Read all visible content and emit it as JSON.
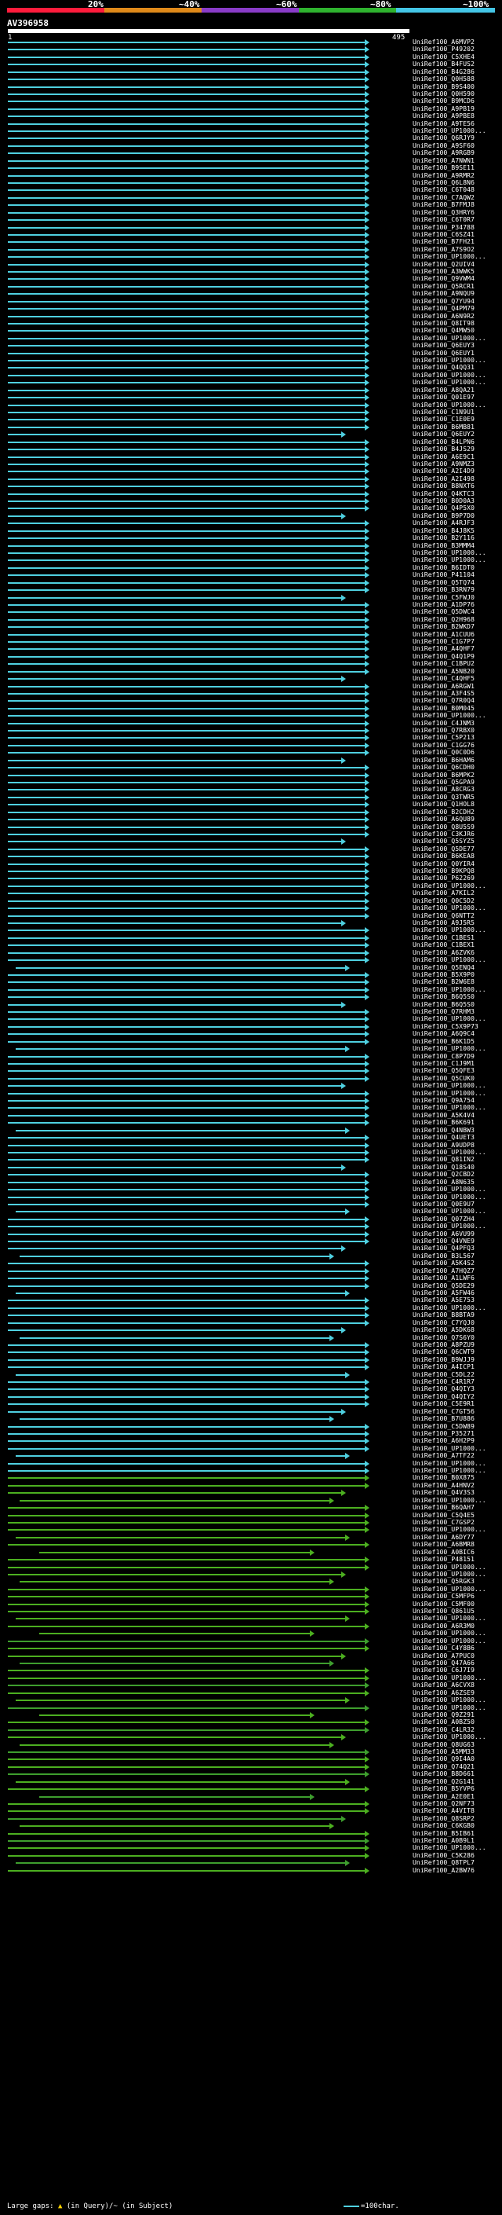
{
  "scale": {
    "labels": [
      "20%",
      "~40%",
      "~60%",
      "~80%",
      "~100%"
    ],
    "colors": [
      "#ff1c3c",
      "#e08a1a",
      "#8a3cc8",
      "#2fb32f",
      "#44c6e6"
    ]
  },
  "query": {
    "name": "AV396958",
    "start": "1",
    "end": "495"
  },
  "legend": {
    "text_a": "Large gaps: ",
    "text_b": " (in Query)/",
    "text_c": "~ (in Subject)",
    "right": "=100char."
  },
  "hits": [
    "UniRef100_A6MVP2",
    "UniRef100_P49202",
    "UniRef100_C5XHE4",
    "UniRef100_B4FUS2",
    "UniRef100_B4G286",
    "UniRef100_Q0H588",
    "UniRef100_B9S400",
    "UniRef100_Q0H590",
    "UniRef100_B9MCD6",
    "UniRef100_A9PB19",
    "UniRef100_A9PBE8",
    "UniRef100_A9TE56",
    "UniRef100_UP1000...",
    "UniRef100_Q6RJY9",
    "UniRef100_A9SF60",
    "UniRef100_A9RGB9",
    "UniRef100_A7NWN1",
    "UniRef100_B9SE11",
    "UniRef100_A9RMR2",
    "UniRef100_Q6L8N6",
    "UniRef100_C6T048",
    "UniRef100_C7AQW2",
    "UniRef100_B7FMJ8",
    "UniRef100_Q3HRY6",
    "UniRef100_C6T0R7",
    "UniRef100_P34788",
    "UniRef100_C6SZ41",
    "UniRef100_B7FH21",
    "UniRef100_A7S9O2",
    "UniRef100_UP1000...",
    "UniRef100_Q2UIV4",
    "UniRef100_A3WWK5",
    "UniRef100_Q9VWM4",
    "UniRef100_Q5RCR1",
    "UniRef100_A9NQU9",
    "UniRef100_Q7YU94",
    "UniRef100_Q4PM79",
    "UniRef100_A6N9R2",
    "UniRef100_Q8IT98",
    "UniRef100_Q4MW50",
    "UniRef100_UP1000...",
    "UniRef100_Q6EUY3",
    "UniRef100_Q6EUY1",
    "UniRef100_UP1000...",
    "UniRef100_Q4QQ31",
    "UniRef100_UP1000...",
    "UniRef100_UP1000...",
    "UniRef100_A8QA21",
    "UniRef100_Q01E97",
    "UniRef100_UP1000...",
    "UniRef100_C1N9U1",
    "UniRef100_C1E0E9",
    "UniRef100_B6MB81",
    "UniRef100_Q6EUY2",
    "UniRef100_B4LPN6",
    "UniRef100_B4JS29",
    "UniRef100_A6E9C1",
    "UniRef100_A9NMZ3",
    "UniRef100_A2I4D9",
    "UniRef100_A2I498",
    "UniRef100_B8NXT6",
    "UniRef100_Q4KTC3",
    "UniRef100_B0D0A3",
    "UniRef100_Q4P5X0",
    "UniRef100_B9P7D0",
    "UniRef100_A4RJF3",
    "UniRef100_B4J8K5",
    "UniRef100_B2Y116",
    "UniRef100_B3MMM4",
    "UniRef100_UP1000...",
    "UniRef100_UP1000...",
    "UniRef100_B6IDT0",
    "UniRef100_P41104",
    "UniRef100_Q5TQ74",
    "UniRef100_B3RN79",
    "UniRef100_C5FWJ0",
    "UniRef100_A1DP76",
    "UniRef100_Q5DWC4",
    "UniRef100_Q2H968",
    "UniRef100_B2WKD7",
    "UniRef100_A1CUU6",
    "UniRef100_C1G7P7",
    "UniRef100_A4QHF7",
    "UniRef100_Q4Q1P9",
    "UniRef100_C1BPU2",
    "UniRef100_A5NB20",
    "UniRef100_C4QHF5",
    "UniRef100_A6RGW1",
    "UniRef100_A3F4S5",
    "UniRef100_Q7R0Q4",
    "UniRef100_B0M045",
    "UniRef100_UP1000...",
    "UniRef100_C4JNM3",
    "UniRef100_Q7RBX0",
    "UniRef100_C5P213",
    "UniRef100_C1GG76",
    "UniRef100_Q0C0D6",
    "UniRef100_B6HAM6",
    "UniRef100_Q6CDH0",
    "UniRef100_B6MPK2",
    "UniRef100_Q5GPA9",
    "UniRef100_A8CRG3",
    "UniRef100_Q3TWR5",
    "UniRef100_Q1HOL8",
    "UniRef100_B2CDH2",
    "UniRef100_A6QU89",
    "UniRef100_Q8U5S9",
    "UniRef100_C3KJR6",
    "UniRef100_Q5SYZ5",
    "UniRef100_Q5DE77",
    "UniRef100_B6KEA8",
    "UniRef100_Q0YIR4",
    "UniRef100_B9KPQ8",
    "UniRef100_P62269",
    "UniRef100_UP1000...",
    "UniRef100_A7KIL2",
    "UniRef100_Q0C5D2",
    "UniRef100_UP1000...",
    "UniRef100_Q6NTT2",
    "UniRef100_A9J5R5",
    "UniRef100_UP1000...",
    "UniRef100_C1BES1",
    "UniRef100_C1BEX1",
    "UniRef100_A6ZVK6",
    "UniRef100_UP1000...",
    "UniRef100_Q5ENQ4",
    "UniRef100_B5X9P0",
    "UniRef100_B2W6E8",
    "UniRef100_UP1000...",
    "UniRef100_B6Q5S0",
    "UniRef100_B6Q5S0",
    "UniRef100_Q7RHM3",
    "UniRef100_UP1000...",
    "UniRef100_C5X9P73",
    "UniRef100_A6Q9C4",
    "UniRef100_B6K1D5",
    "UniRef100_UP1000...",
    "UniRef100_C8P7D9",
    "UniRef100_C1J9M1",
    "UniRef100_Q5QFE3",
    "UniRef100_Q5CUK0",
    "UniRef100_UP1000...",
    "UniRef100_UP1000...",
    "UniRef100_Q9A754",
    "UniRef100_UP1000...",
    "UniRef100_A5K4V4",
    "UniRef100_B6K691",
    "UniRef100_Q4NBW3",
    "UniRef100_Q4UET3",
    "UniRef100_A9UDP8",
    "UniRef100_UP1000...",
    "UniRef100_Q81IN2",
    "UniRef100_Q18S40",
    "UniRef100_Q2CBD2",
    "UniRef100_A8N635",
    "UniRef100_UP1000...",
    "UniRef100_UP1000...",
    "UniRef100_Q0E9U7",
    "UniRef100_UP1000...",
    "UniRef100_Q07ZH4",
    "UniRef100_UP1000...",
    "UniRef100_A6VU99",
    "UniRef100_Q4VNE9",
    "UniRef100_Q4PFQ3",
    "UniRef100_B3L567",
    "UniRef100_A5K4S2",
    "UniRef100_A7HQZ7",
    "UniRef100_A1LWF6",
    "UniRef100_Q5DE29",
    "UniRef100_A5FW46",
    "UniRef100_A5E753",
    "UniRef100_UP1000...",
    "UniRef100_B8BTA9",
    "UniRef100_C7YQJ0",
    "UniRef100_A5DK68",
    "UniRef100_Q7S6Y0",
    "UniRef100_A8PZU9",
    "UniRef100_Q6CWT9",
    "UniRef100_B9WJJ9",
    "UniRef100_A4ICP1",
    "UniRef100_C5DL22",
    "UniRef100_C4R1R7",
    "UniRef100_Q4QIY3",
    "UniRef100_Q4QIY2",
    "UniRef100_C5E9R1",
    "UniRef100_C7GT56",
    "UniRef100_B7U886",
    "UniRef100_C5DW89",
    "UniRef100_P35271",
    "UniRef100_A6H2P9",
    "UniRef100_UP1000...",
    "UniRef100_A7TF22",
    "UniRef100_UP1000...",
    "UniRef100_UP1000...",
    "UniRef100_B0X875",
    "UniRef100_A4HNV2",
    "UniRef100_Q4V3S3",
    "UniRef100_UP1000...",
    "UniRef100_B6QAH7",
    "UniRef100_C5Q4E5",
    "UniRef100_C7GSP2",
    "UniRef100_UP1000...",
    "UniRef100_A6DY77",
    "UniRef100_A6BMR8",
    "UniRef100_A0BIC6",
    "UniRef100_P48151",
    "UniRef100_UP1000...",
    "UniRef100_UP1000...",
    "UniRef100_Q5RGK3",
    "UniRef100_UP1000...",
    "UniRef100_C5MFP6",
    "UniRef100_C5MF00",
    "UniRef100_Q861U5",
    "UniRef100_UP1000...",
    "UniRef100_A6R3M0",
    "UniRef100_UP1000...",
    "UniRef100_UP1000...",
    "UniRef100_C4Y8B6",
    "UniRef100_A7PUC0",
    "UniRef100_Q47A66",
    "UniRef100_C6J7I9",
    "UniRef100_UP1000...",
    "UniRef100_A6CVX8",
    "UniRef100_A6ZSE9",
    "UniRef100_UP1000...",
    "UniRef100_UP1000...",
    "UniRef100_Q9Z291",
    "UniRef100_A0BZ50",
    "UniRef100_C4LR32",
    "UniRef100_UP1000...",
    "UniRef100_Q8UG63",
    "UniRef100_A5MM33",
    "UniRef100_Q9I4A0",
    "UniRef100_Q74Q21",
    "UniRef100_B8D661",
    "UniRef100_Q2G141",
    "UniRef100_B5YVP6",
    "UniRef100_A2E0E1",
    "UniRef100_Q2NF73",
    "UniRef100_A4VIT8",
    "UniRef100_Q8SRP2",
    "UniRef100_C6KGB0",
    "UniRef100_B5IB61",
    "UniRef100_A0B9L1",
    "UniRef100_UP1000...",
    "UniRef100_C5K286",
    "UniRef100_Q8TPL7",
    "UniRef100_A2BW76"
  ]
}
